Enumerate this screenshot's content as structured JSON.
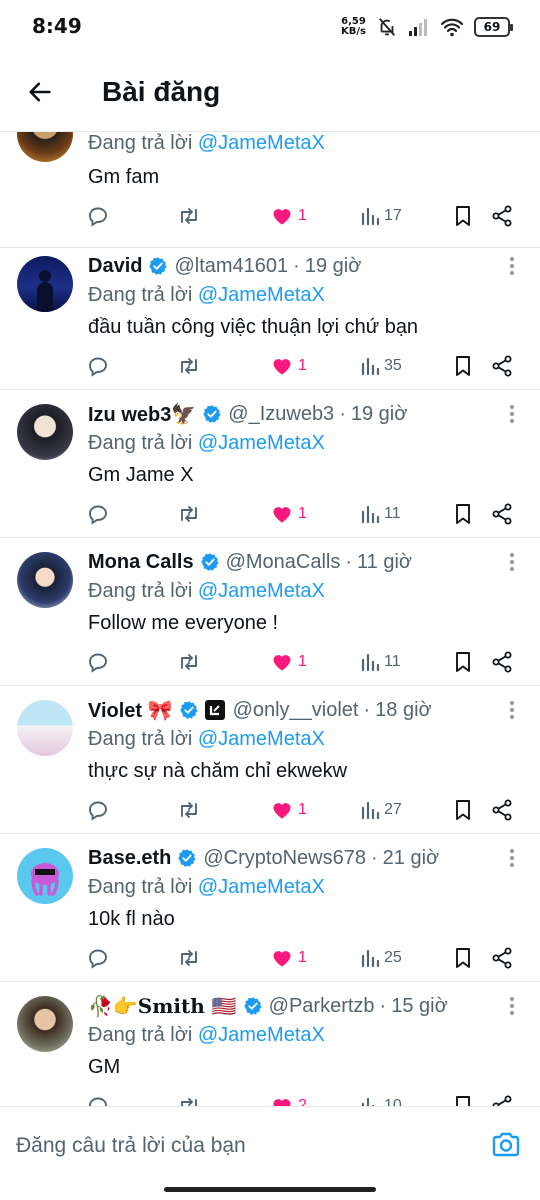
{
  "status_bar": {
    "time": "8:49",
    "net_speed_value": "6,59",
    "net_speed_unit": "KB/s",
    "battery": "69"
  },
  "header": {
    "title": "Bài đăng"
  },
  "reply_prefix": "Đang trả lời",
  "posts": [
    {
      "name": "",
      "handle": "",
      "time": "",
      "reply_to": "@JameMetaX",
      "text": "Gm fam",
      "likes": "1",
      "views": "17"
    },
    {
      "name": "David",
      "handle": "@ltam41601",
      "time": "19 giờ",
      "reply_to": "@JameMetaX",
      "text": "đầu tuần công việc thuận lợi chứ bạn",
      "likes": "1",
      "views": "35"
    },
    {
      "name": "Izu web3🦅",
      "handle": "@_Izuweb3",
      "time": "19 giờ",
      "reply_to": "@JameMetaX",
      "text": "Gm Jame X",
      "likes": "1",
      "views": "11"
    },
    {
      "name": "Mona Calls",
      "handle": "@MonaCalls",
      "time": "11 giờ",
      "reply_to": "@JameMetaX",
      "text": "Follow me everyone !",
      "likes": "1",
      "views": "11"
    },
    {
      "name": "Violet 🎀",
      "handle": "@only__violet",
      "time": "18 giờ",
      "reply_to": "@JameMetaX",
      "text": "thực sự nà chăm chỉ ekwekw",
      "likes": "1",
      "views": "27"
    },
    {
      "name": "Base.eth",
      "handle": "@CryptoNews678",
      "time": "21 giờ",
      "reply_to": "@JameMetaX",
      "text": "10k fl nào",
      "likes": "1",
      "views": "25"
    },
    {
      "name": "🥀👉𝐒𝐦𝐢𝐭𝐡 🇺🇸",
      "handle": "@Parkertzb",
      "time": "15 giờ",
      "reply_to": "@JameMetaX",
      "text": "GM",
      "likes": "2",
      "views": "10"
    }
  ],
  "composer": {
    "placeholder": "Đăng câu trả lời của bạn"
  },
  "colors": {
    "accent": "#1d9bf0",
    "like": "#f91880",
    "secondary_text": "#536471",
    "divider": "#e6e9ea"
  },
  "icons": {
    "verified": "verified-badge-icon",
    "reply": "reply-icon",
    "repost": "repost-icon",
    "like": "heart-icon",
    "views": "views-icon",
    "bookmark": "bookmark-icon",
    "share": "share-icon",
    "more": "more-vertical-icon",
    "back": "arrow-left-icon",
    "camera": "camera-icon"
  }
}
